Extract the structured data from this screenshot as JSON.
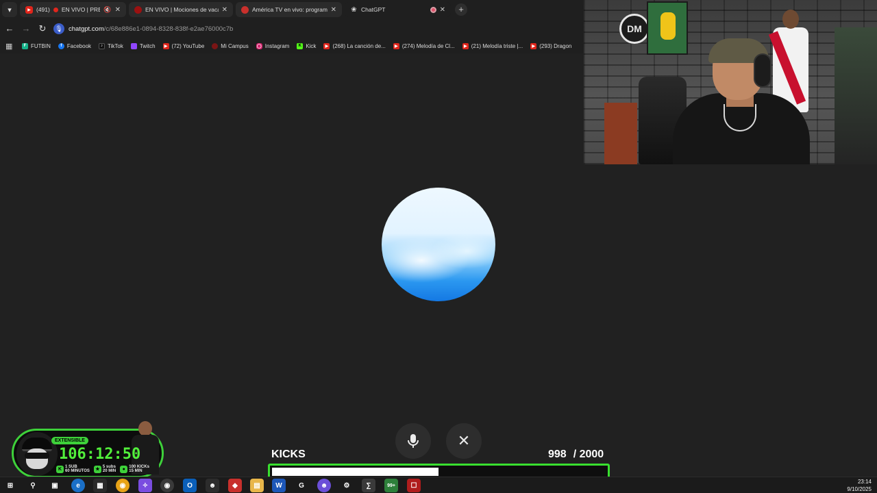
{
  "browser": {
    "tabs": [
      {
        "label": "(491)",
        "live_text": "EN VIVO | PRESEN",
        "icon": "youtube-icon",
        "muted": true
      },
      {
        "label": "EN VIVO | Mociones de vacancia",
        "icon": "channel-icon"
      },
      {
        "label": "América TV en vivo: programación",
        "icon": "globe-icon"
      },
      {
        "label": "ChatGPT",
        "icon": "chatgpt-icon",
        "active": true,
        "recording": true
      }
    ],
    "url_host": "chatgpt.com",
    "url_path": "/c/68e886e1-0894-8328-838f-e2ae76000c7b",
    "bookmarks": [
      {
        "label": "FUTBIN",
        "icon": "futbin-icon"
      },
      {
        "label": "Facebook",
        "icon": "facebook-icon"
      },
      {
        "label": "TikTok",
        "icon": "tiktok-icon"
      },
      {
        "label": "Twitch",
        "icon": "twitch-icon"
      },
      {
        "label": "(72) YouTube",
        "icon": "youtube-icon"
      },
      {
        "label": "Mi Campus",
        "icon": "campus-icon"
      },
      {
        "label": "Instagram",
        "icon": "instagram-icon"
      },
      {
        "label": "Kick",
        "icon": "kick-icon"
      },
      {
        "label": "(268) La canción de...",
        "icon": "youtube-icon"
      },
      {
        "label": "(274) Melodía de Cl...",
        "icon": "youtube-icon"
      },
      {
        "label": "(21) Melodía triste |...",
        "icon": "youtube-icon"
      },
      {
        "label": "(293) Dragon",
        "icon": "youtube-icon"
      }
    ]
  },
  "voice_controls": {
    "mic": "microphone-icon",
    "close": "✕"
  },
  "timer_widget": {
    "badge": "EXTENSIBLE",
    "time": "106:12:50",
    "rules": [
      {
        "line1": "1 SUB",
        "line2": "60 MINUTOS"
      },
      {
        "line1": "5 subs",
        "line2": "20 MIN"
      },
      {
        "line1": "100 KICKs",
        "line2": "15 MIN"
      }
    ]
  },
  "kicks_goal": {
    "label": "KICKS",
    "current": "998",
    "target": "/ 2000",
    "progress": 0.499
  },
  "taskbar": {
    "time": "23:14",
    "date": "9/10/2025",
    "notification_badge": "99+"
  },
  "colors": {
    "page_bg": "#212121",
    "accent_green": "#39e02f",
    "orb_blue": "#1478e3"
  }
}
